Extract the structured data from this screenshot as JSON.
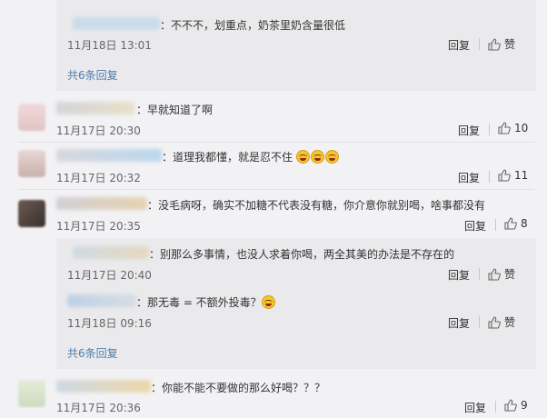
{
  "thread1": {
    "reply1": {
      "text": "：不不不，划重点，奶茶里奶含量很低",
      "time": "11月18日 13:01",
      "reply_label": "回复",
      "like_label": "赞"
    },
    "more_link": "共6条回复"
  },
  "comment2": {
    "text": "：早就知道了啊",
    "time": "11月17日 20:30",
    "reply_label": "回复",
    "likes": "10"
  },
  "comment3": {
    "text": "：道理我都懂，就是忍不住",
    "time": "11月17日 20:32",
    "reply_label": "回复",
    "likes": "11"
  },
  "comment4": {
    "text": "：没毛病呀，确实不加糖不代表没有糖，你介意你就别喝，啥事都没有",
    "time": "11月17日 20:35",
    "reply_label": "回复",
    "likes": "8",
    "reply1": {
      "text": "：别那么多事情，也没人求着你喝，两全其美的办法是不存在的",
      "time": "11月17日 20:40",
      "reply_label": "回复",
      "like_label": "赞"
    },
    "reply2": {
      "text": "：那无毒 = 不额外投毒？",
      "time": "11月18日 09:16",
      "reply_label": "回复",
      "like_label": "赞"
    },
    "more_link": "共6条回复"
  },
  "comment5": {
    "text": "：你能不能不要做的那么好喝？？？",
    "time": "11月17日 20:36",
    "reply_label": "回复",
    "likes": "9"
  },
  "colors": {
    "link": "#507daf",
    "background": "#f2f2f5",
    "reply_background": "#eaeaec"
  },
  "icons": {
    "like": "thumbs-up-icon",
    "emoji": "laughing-emoji-icon"
  }
}
